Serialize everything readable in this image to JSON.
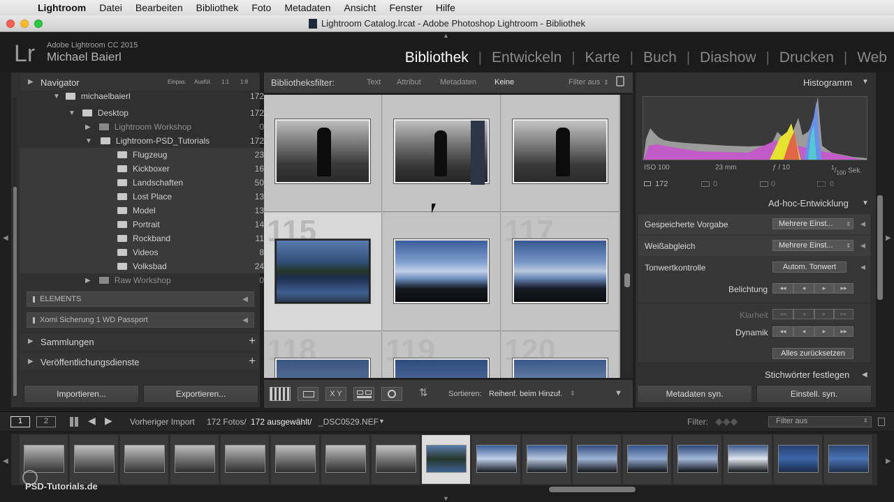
{
  "menubar": {
    "app": "Lightroom",
    "items": [
      "Datei",
      "Bearbeiten",
      "Bibliothek",
      "Foto",
      "Metadaten",
      "Ansicht",
      "Fenster",
      "Hilfe"
    ]
  },
  "window": {
    "title": "Lightroom Catalog.lrcat - Adobe Photoshop Lightroom - Bibliothek"
  },
  "identity": {
    "product": "Adobe Lightroom CC 2015",
    "user": "Michael Baierl"
  },
  "modules": [
    "Bibliothek",
    "Entwickeln",
    "Karte",
    "Buch",
    "Diashow",
    "Drucken",
    "Web"
  ],
  "navigator": {
    "title": "Navigator",
    "zoom": [
      "Einpas.",
      "Ausfül.",
      "1:1",
      "1:8"
    ]
  },
  "folders": [
    {
      "name": "michaelbaierl",
      "count": "172"
    },
    {
      "name": "Desktop",
      "count": "172"
    },
    {
      "name": "Lightroom Workshop",
      "count": "0"
    },
    {
      "name": "Lightroom-PSD_Tutorials",
      "count": "172"
    },
    {
      "name": "Flugzeug",
      "count": "23"
    },
    {
      "name": "Kickboxer",
      "count": "16"
    },
    {
      "name": "Landschaften",
      "count": "50"
    },
    {
      "name": "Lost Place",
      "count": "13"
    },
    {
      "name": "Model",
      "count": "13"
    },
    {
      "name": "Portrait",
      "count": "14"
    },
    {
      "name": "Rockband",
      "count": "11"
    },
    {
      "name": "Videos",
      "count": "8"
    },
    {
      "name": "Volksbad",
      "count": "24"
    },
    {
      "name": "Raw Workshop",
      "count": "0"
    }
  ],
  "volumes": [
    "ELEMENTS",
    "Xomi Sicherung 1 WD Passport"
  ],
  "left_sections": {
    "collections": "Sammlungen",
    "publish": "Veröffentlichungsdienste"
  },
  "left_buttons": {
    "import": "Importieren...",
    "export": "Exportieren..."
  },
  "filterbar": {
    "label": "Bibliotheksfilter:",
    "options": [
      "Text",
      "Attribut",
      "Metadaten",
      "Keine"
    ],
    "state": "Filter aus"
  },
  "grid": {
    "cell_numbers": [
      "115",
      "117",
      "118",
      "119",
      "120"
    ]
  },
  "toolbar": {
    "sort_label": "Sortieren:",
    "sort_value": "Reihenf. beim Hinzuf."
  },
  "histogram": {
    "title": "Histogramm",
    "iso": "ISO 100",
    "focal": "23 mm",
    "aperture": "ƒ / 10",
    "shutter_num": "1",
    "shutter_den": "100",
    "shutter_unit": "Sek.",
    "photo_count": "172",
    "c1": "0",
    "c2": "0",
    "c3": "0"
  },
  "quickdev": {
    "title": "Ad-hoc-Entwicklung",
    "preset_label": "Gespeicherte Vorgabe",
    "preset_value": "Mehrere Einst...",
    "wb_label": "Weißabgleich",
    "wb_value": "Mehrere Einst...",
    "tone_label": "Tonwertkontrolle",
    "auto_tone": "Autom. Tonwert",
    "exposure": "Belichtung",
    "clarity": "Klarheit",
    "vibrance": "Dynamik",
    "reset": "Alles zurücksetzen",
    "stepper": [
      "◂◂",
      "◂",
      "▸",
      "▸▸"
    ]
  },
  "keywords": {
    "title": "Stichwörter festlegen"
  },
  "right_buttons": {
    "sync_meta": "Metadaten syn.",
    "sync_settings": "Einstell. syn."
  },
  "filmstrip_bar": {
    "page1": "1",
    "page2": "2",
    "source": "Vorheriger Import",
    "photos": "172 Fotos/",
    "selected": "172 ausgewählt/",
    "file": "_DSC0529.NEF",
    "filter_label": "Filter:",
    "filter_value": "Filter aus"
  },
  "watermark": "PSD-Tutorials.de"
}
